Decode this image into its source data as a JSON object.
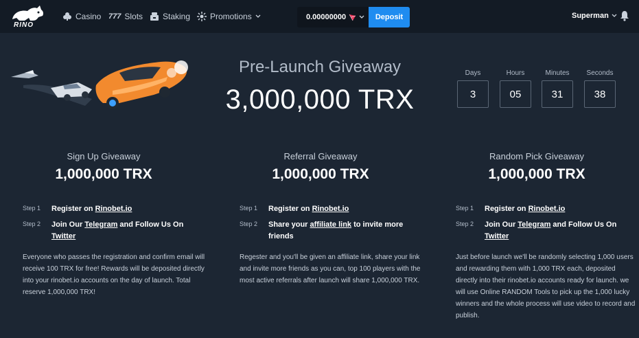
{
  "nav": {
    "logo_text": "RINO",
    "items": [
      {
        "label": "Casino",
        "icon": "club-icon"
      },
      {
        "label": "Slots",
        "icon": "slots-777-icon"
      },
      {
        "label": "Staking",
        "icon": "staking-icon"
      },
      {
        "label": "Promotions",
        "icon": "promotions-icon"
      }
    ],
    "balance": "0.00000000",
    "currency_icon": "trx-icon",
    "deposit_label": "Deposit",
    "username": "Superman"
  },
  "hero": {
    "title": "Pre-Launch Giveaway",
    "amount": "3,000,000 TRX"
  },
  "countdown": [
    {
      "label": "Days",
      "value": "3"
    },
    {
      "label": "Hours",
      "value": "05"
    },
    {
      "label": "Minutes",
      "value": "31"
    },
    {
      "label": "Seconds",
      "value": "38"
    }
  ],
  "columns": [
    {
      "title": "Sign Up Giveaway",
      "amount": "1,000,000 TRX",
      "step1_label": "Step 1",
      "step1_pre": "Register on ",
      "step1_link": "Rinobet.io",
      "step2_label": "Step 2",
      "step2_pre": "Join Our ",
      "step2_link1": "Telegram",
      "step2_mid": " and Follow Us On ",
      "step2_link2": "Twitter",
      "desc": "Everyone who passes the registration and confirm email will receive 100 TRX for free! Rewards will be deposited directly into your rinobet.io accounts on the day of launch. Total reserve 1,000,000 TRX!"
    },
    {
      "title": "Referral Giveaway",
      "amount": "1,000,000 TRX",
      "step1_label": "Step 1",
      "step1_pre": "Register on ",
      "step1_link": "Rinobet.io",
      "step2_label": "Step 2",
      "step2_pre": "Share your ",
      "step2_link1": "affiliate link",
      "step2_mid": " to invite more friends",
      "desc": "Regester and you'll be given an affiliate link, share your link and invite more friends as you can, top 100 players with the most active referrals after launch will share 1,000,000 TRX."
    },
    {
      "title": "Random Pick Giveaway",
      "amount": "1,000,000 TRX",
      "step1_label": "Step 1",
      "step1_pre": "Register on ",
      "step1_link": "Rinobet.io",
      "step2_label": "Step 2",
      "step2_pre": "Join Our ",
      "step2_link1": "Telegram",
      "step2_mid": " and Follow Us On ",
      "step2_link2": "Twitter",
      "desc": "Just before launch we'll be randomly selecting 1,000 users and rewarding them with 1,000 TRX each, deposited directly into their rinobet.io accounts ready for launch. we will use Online RANDOM Tools to pick up the 1,000 lucky winners and the whole process will use video to record and publish."
    }
  ],
  "colors": {
    "background": "#1c2633",
    "nav_background": "#131b25",
    "accent": "#1f8cf0",
    "car": "#f28a2e"
  }
}
